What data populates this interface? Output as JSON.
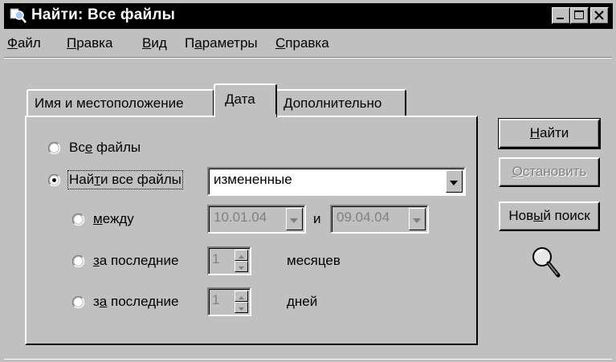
{
  "window": {
    "title": "Найти: Все файлы",
    "icon": "magnifier-icon"
  },
  "menu": {
    "file": {
      "accel": "Ф",
      "rest": "айл"
    },
    "edit": {
      "accel": "П",
      "rest": "равка"
    },
    "view": {
      "accel": "В",
      "rest": "ид"
    },
    "params": {
      "pre": "П",
      "accel": "а",
      "rest": "раметры"
    },
    "help": {
      "accel": "С",
      "rest": "правка"
    }
  },
  "tabs": {
    "name_location": "Имя и местоположение",
    "date": "Дата",
    "advanced": "Дополнительно"
  },
  "date_tab": {
    "all_files": {
      "pre": "Вс",
      "accel": "е",
      "rest": " файлы",
      "checked": false
    },
    "find_all": {
      "pre": "Най",
      "accel": "т",
      "rest": "и все файлы",
      "checked": true
    },
    "type_value": "измененные",
    "between": {
      "accel": "м",
      "rest": "ежду",
      "checked": false
    },
    "from_date": "10.01.04",
    "and_label": "и",
    "to_date": "09.04.04",
    "last_months": {
      "accel": "з",
      "rest": "а последние",
      "checked": false,
      "value": "1",
      "unit": "месяцев"
    },
    "last_days": {
      "pre": "з",
      "accel": "а",
      "rest": " последние",
      "checked": false,
      "value": "1",
      "unit": "дней"
    }
  },
  "buttons": {
    "find": {
      "accel": "Н",
      "rest": "айти"
    },
    "stop": {
      "accel": "О",
      "rest": "становить"
    },
    "new_search": {
      "pre": "Нов",
      "accel": "ы",
      "rest": "й поиск"
    }
  },
  "animation_icon": "magnifier-icon"
}
